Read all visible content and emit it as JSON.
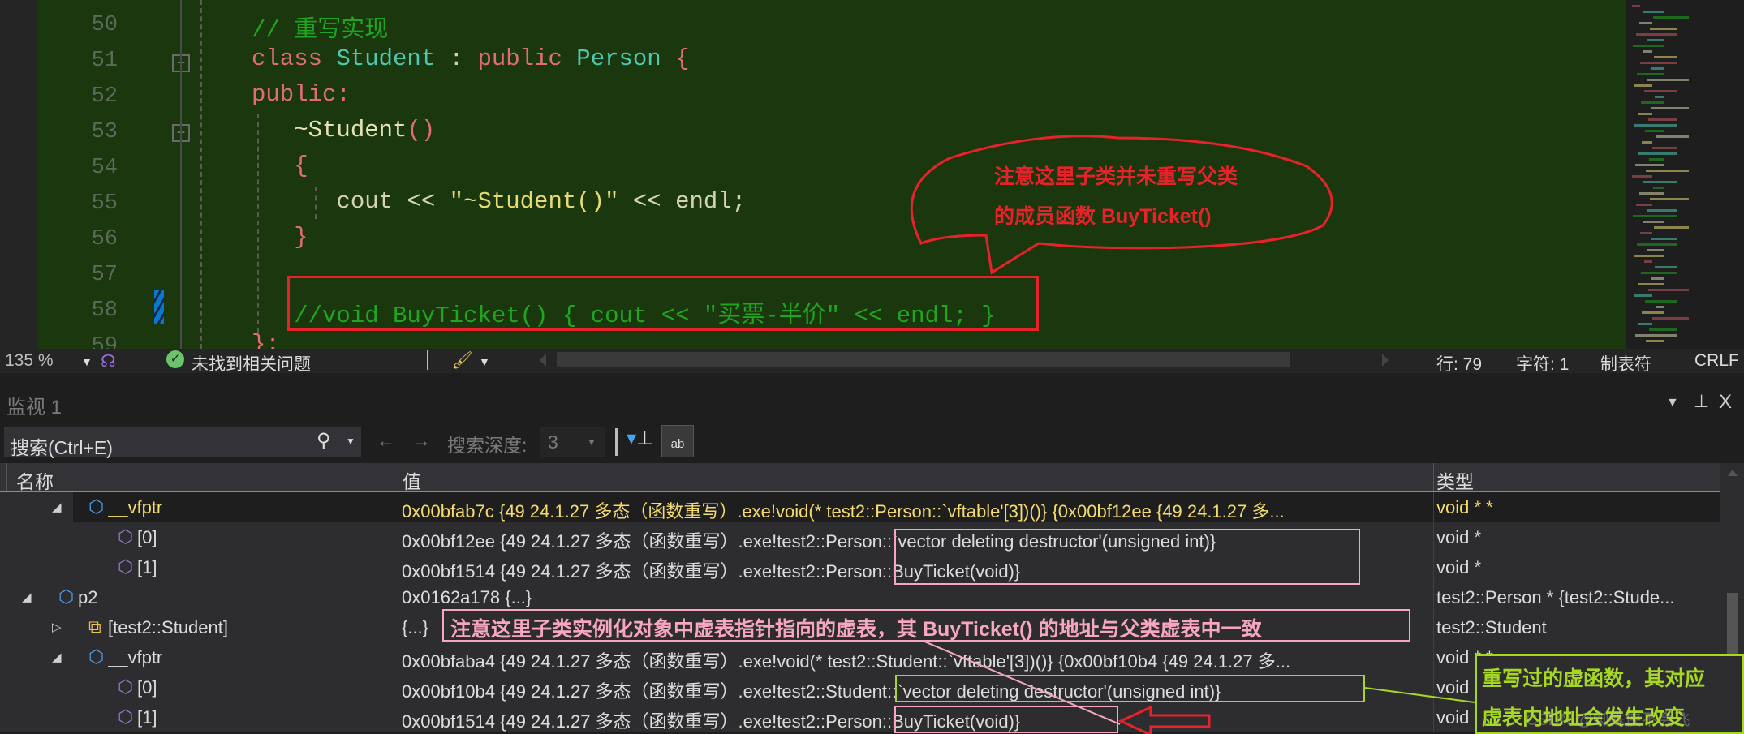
{
  "editor": {
    "lines": [
      {
        "num": "50",
        "tokens": [
          {
            "t": "// 重写实现",
            "c": "#1fa51f"
          }
        ]
      },
      {
        "num": "51",
        "tokens": [
          {
            "t": "class ",
            "c": "#e06c78"
          },
          {
            "t": "Student",
            "c": "#4ec9b0"
          },
          {
            "t": " : ",
            "c": "#d4d4b4"
          },
          {
            "t": "public ",
            "c": "#e06c78"
          },
          {
            "t": "Person",
            "c": "#4ec9b0"
          },
          {
            "t": " {",
            "c": "#e06c78"
          }
        ]
      },
      {
        "num": "52",
        "tokens": [
          {
            "t": "public:",
            "c": "#e06c78"
          }
        ]
      },
      {
        "num": "53",
        "tokens": [
          {
            "t": "   ~Student",
            "c": "#e6e2b8"
          },
          {
            "t": "()",
            "c": "#e06c78"
          }
        ]
      },
      {
        "num": "54",
        "tokens": [
          {
            "t": "   {",
            "c": "#e06c78"
          }
        ]
      },
      {
        "num": "55",
        "tokens": [
          {
            "t": "      cout << ",
            "c": "#d4d4b4"
          },
          {
            "t": "\"~Student()\"",
            "c": "#e6db74"
          },
          {
            "t": " << endl;",
            "c": "#d4d4b4"
          }
        ]
      },
      {
        "num": "56",
        "tokens": [
          {
            "t": "   }",
            "c": "#e06c78"
          }
        ]
      },
      {
        "num": "57",
        "tokens": []
      },
      {
        "num": "58",
        "tokens": [
          {
            "t": "   //void BuyTicket() { cout << \"买票-半价\" << endl; }",
            "c": "#1fa51f"
          }
        ]
      },
      {
        "num": "59",
        "tokens": [
          {
            "t": "};",
            "c": "#e06c78"
          }
        ]
      }
    ]
  },
  "status": {
    "zoom": "135 %",
    "issues": "未找到相关问题",
    "line": "行: 79",
    "char": "字符: 1",
    "tabs": "制表符",
    "eol": "CRLF"
  },
  "panel": {
    "title": "监视 1",
    "search_placeholder": "搜索(Ctrl+E)",
    "depth_label": "搜索深度:",
    "depth_value": "3"
  },
  "columns": {
    "name": "名称",
    "value": "值",
    "type": "类型"
  },
  "rows": [
    {
      "level": 1,
      "expander": "expanded",
      "icon": "field-icon",
      "name": "__vfptr",
      "value": "0x00bfab7c {49 24.1.27 多态（函数重写）.exe!void(* test2::Person::`vftable'[3])()} {0x00bf12ee {49 24.1.27 多...",
      "type": "void * *",
      "selected": true
    },
    {
      "level": 2,
      "expander": "none",
      "icon": "element-icon",
      "name": "[0]",
      "value": "0x00bf12ee {49 24.1.27 多态（函数重写）.exe!test2::Person::`vector deleting destructor'(unsigned int)}",
      "type": "void *"
    },
    {
      "level": 2,
      "expander": "none",
      "icon": "element-icon",
      "name": "[1]",
      "value": "0x00bf1514 {49 24.1.27 多态（函数重写）.exe!test2::Person::BuyTicket(void)}",
      "type": "void *"
    },
    {
      "level": 0,
      "expander": "expanded",
      "icon": "field-icon",
      "name": "p2",
      "value": "0x0162a178 {...}",
      "type": "test2::Person * {test2::Stude..."
    },
    {
      "level": 1,
      "expander": "collapsed",
      "icon": "class-icon",
      "name": "[test2::Student]",
      "value": "{...}",
      "type": "test2::Student"
    },
    {
      "level": 1,
      "expander": "expanded",
      "icon": "field-icon",
      "name": "__vfptr",
      "value": "0x00bfaba4 {49 24.1.27 多态（函数重写）.exe!void(* test2::Student::`vftable'[3])()} {0x00bf10b4 {49 24.1.27 多...",
      "type": "void * *"
    },
    {
      "level": 2,
      "expander": "none",
      "icon": "element-icon",
      "name": "[0]",
      "value": "0x00bf10b4 {49 24.1.27 多态（函数重写）.exe!test2::Student::`vector deleting destructor'(unsigned int)}",
      "type": "void *"
    },
    {
      "level": 2,
      "expander": "none",
      "icon": "element-icon",
      "name": "[1]",
      "value": "0x00bf1514 {49 24.1.27 多态（函数重写）.exe!test2::Person::BuyTicket(void)}",
      "type": "void *"
    }
  ],
  "annotations": {
    "callout_line1": "注意这里子类并未重写父类",
    "callout_line2": "的成员函数 BuyTicket()",
    "pink_note": "注意这里子类实例化对象中虚表指针指向的虚表，其 BuyTicket() 的地址与父类虚表中一致",
    "green_line1": "重写过的虚函数，其对应",
    "green_line2": "虚表内地址会发生改变",
    "watermark": "CSDN @蜘蛛侠不会飞"
  },
  "colors": {
    "red": "#e8222a",
    "pink": "#f7a6c0",
    "green": "#a6d81f",
    "selected_text": "#f5dc6b"
  }
}
